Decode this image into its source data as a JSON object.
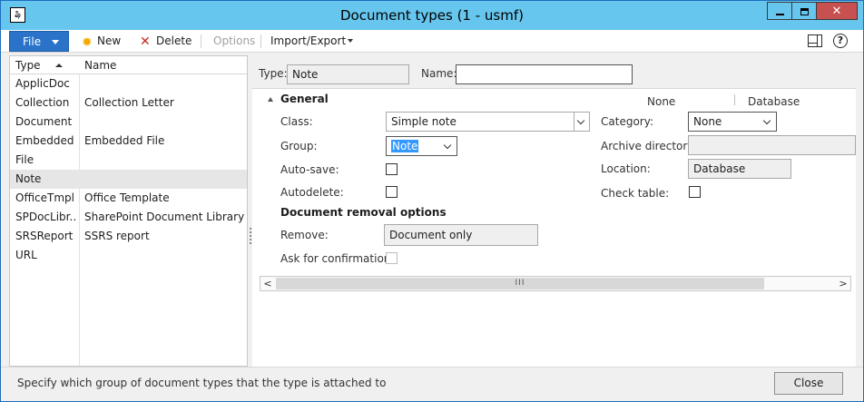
{
  "window": {
    "title": "Document types (1 - usmf)",
    "app_icon_glyph": "₯"
  },
  "toolbar": {
    "file_label": "File",
    "new_label": "New",
    "delete_label": "Delete",
    "options_label": "Options",
    "import_export_label": "Import/Export"
  },
  "list": {
    "columns": {
      "type": "Type",
      "name": "Name"
    },
    "rows": [
      {
        "type": "ApplicDoc",
        "name": ""
      },
      {
        "type": "Collection",
        "name": "Collection Letter"
      },
      {
        "type": "Document",
        "name": ""
      },
      {
        "type": "Embedded",
        "name": "Embedded File"
      },
      {
        "type": "File",
        "name": ""
      },
      {
        "type": "Note",
        "name": ""
      },
      {
        "type": "OfficeTmpl",
        "name": "Office Template"
      },
      {
        "type": "SPDocLibr...",
        "name": "SharePoint Document Library"
      },
      {
        "type": "SRSReport",
        "name": "SSRS report"
      },
      {
        "type": "URL",
        "name": ""
      }
    ],
    "selected_index": 5
  },
  "header": {
    "type_label": "Type:",
    "type_value": "Note",
    "name_label": "Name:",
    "name_value": ""
  },
  "general": {
    "title": "General",
    "col_header_none": "None",
    "col_header_database": "Database",
    "class_label": "Class:",
    "class_value": "Simple note",
    "group_label": "Group:",
    "group_value": "Note",
    "autosave_label": "Auto-save:",
    "autodelete_label": "Autodelete:",
    "category_label": "Category:",
    "category_value": "None",
    "archive_label": "Archive directory:",
    "archive_value": "",
    "location_label": "Location:",
    "location_value": "Database",
    "checktable_label": "Check table:"
  },
  "removal": {
    "title": "Document removal options",
    "remove_label": "Remove:",
    "remove_value": "Document only",
    "confirm_label": "Ask for confirmation:"
  },
  "scrollbar": {
    "thumb_glyph": "III",
    "left_glyph": "<",
    "right_glyph": ">"
  },
  "status": {
    "text": "Specify which group of document types that the type is attached to",
    "close_label": "Close"
  },
  "colors": {
    "titlebar": "#67c6ee",
    "file_button": "#2a73c8",
    "close_window": "#c75050",
    "selection_highlight": "#3399ff"
  }
}
